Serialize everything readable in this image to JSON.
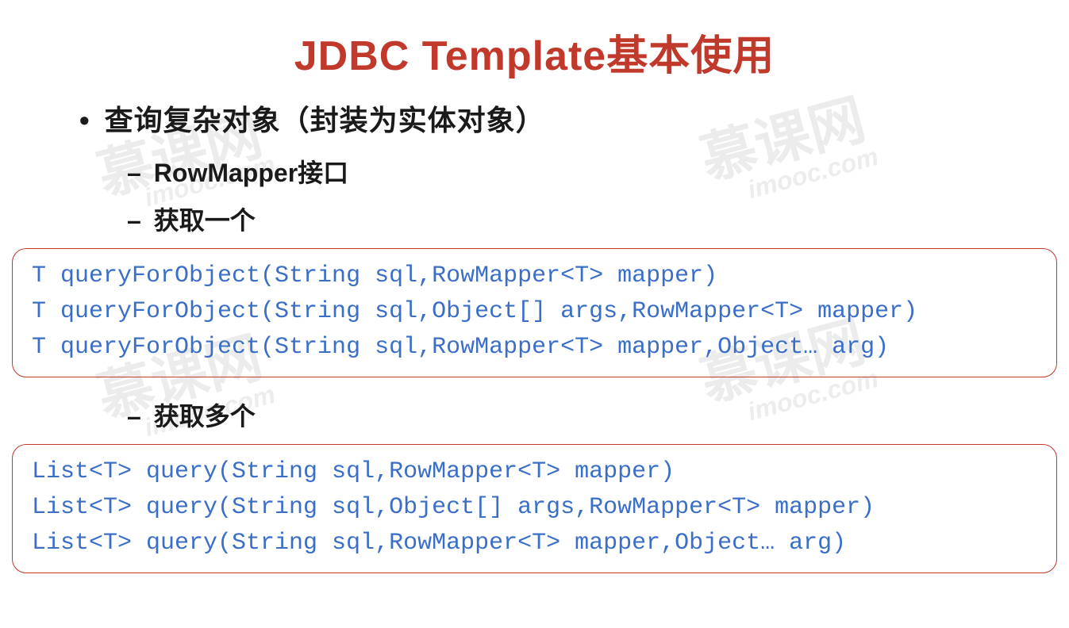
{
  "title": "JDBC Template基本使用",
  "main_bullet": "查询复杂对象（封装为实体对象）",
  "sub_bullets": {
    "rowmapper": "RowMapper接口",
    "get_one": "获取一个",
    "get_many": "获取多个"
  },
  "code_single": {
    "line1": "T queryForObject(String sql,RowMapper<T> mapper)",
    "line2": "T queryForObject(String sql,Object[] args,RowMapper<T> mapper)",
    "line3": "T queryForObject(String sql,RowMapper<T> mapper,Object… arg)"
  },
  "code_multi": {
    "line1": "List<T> query(String sql,RowMapper<T> mapper)",
    "line2": "List<T> query(String sql,Object[] args,RowMapper<T> mapper)",
    "line3": "List<T> query(String sql,RowMapper<T> mapper,Object… arg)"
  },
  "watermark": {
    "cn": "慕课网",
    "en": "imooc.com"
  }
}
